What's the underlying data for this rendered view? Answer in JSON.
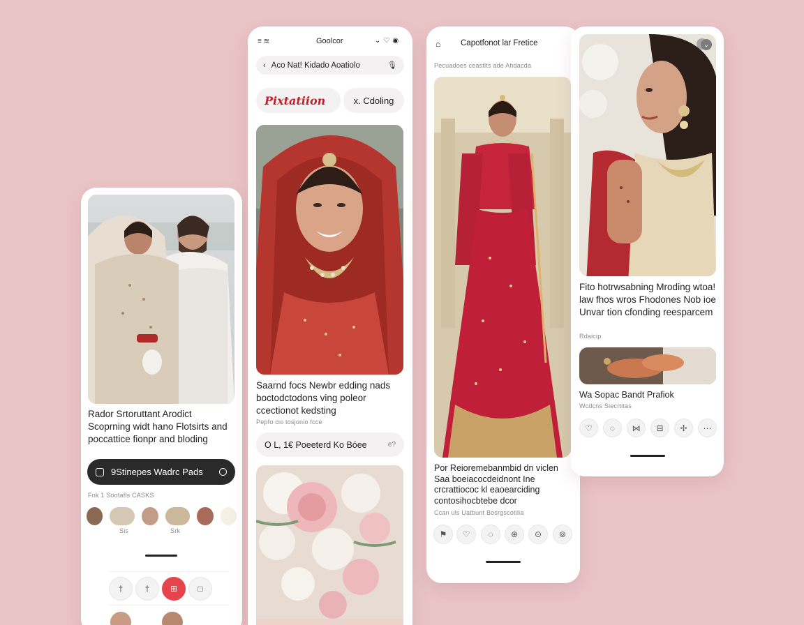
{
  "phone1": {
    "caption": "Rador Srtoruttant Arodict Scoprning widt hano Flotsirts and poccattice fionpr and bloding",
    "meta": "Fnk 1 Sootafls CASKS",
    "cta_label": "9Stinepes Wadrc Pads",
    "avatar_labels": [
      "Sis",
      "Srk"
    ],
    "icons": [
      "search-icon",
      "board-icon",
      "pin-icon",
      "heart-icon"
    ]
  },
  "phone2": {
    "status_left": "≡ ≋",
    "status_center": "Goolcor",
    "search_text": "Aco Nat! Kidado Aoatiolo",
    "brand_label": "Pixtatiion",
    "chip_label": "x. Cdoling",
    "caption": "Saarnd focs Newbr edding nads boctodctodons ving poleor ccectionot kedsting",
    "meta": "Pepfo cio tosjonio fcce",
    "bar_label": "O L, 1€ Poeeterd Ko Bóee",
    "bar_icon": "e?"
  },
  "phone3": {
    "title": "Capotfonot lar Fretice",
    "meta_top": "Pecuadoes ceastlts ade Ahdacda",
    "caption": "Por Reioremebanmbid dn viclen Saa boeiacocdeidnont Ine crcrattiococ kl eaoearciding contosihocbtebe dcor",
    "meta_bottom": "Ccan uls Uatbunt Bosrgscotilia"
  },
  "phone4": {
    "caption": "Fito hotrwsabning Mroding wtoa! law fhos wros Fhodones Nob ioe Unvar tion cfonding reesparcem",
    "meta1": "Rdaicip",
    "thumb_caption": "Wa Sopac Bandt Prafiok",
    "meta2": "Wcdcns Siecrtitas"
  },
  "colors": {
    "background": "#e9c4c6",
    "accent_red": "#e6434a",
    "dark_pill": "#2a2a2a",
    "brand_red": "#c0202a"
  }
}
